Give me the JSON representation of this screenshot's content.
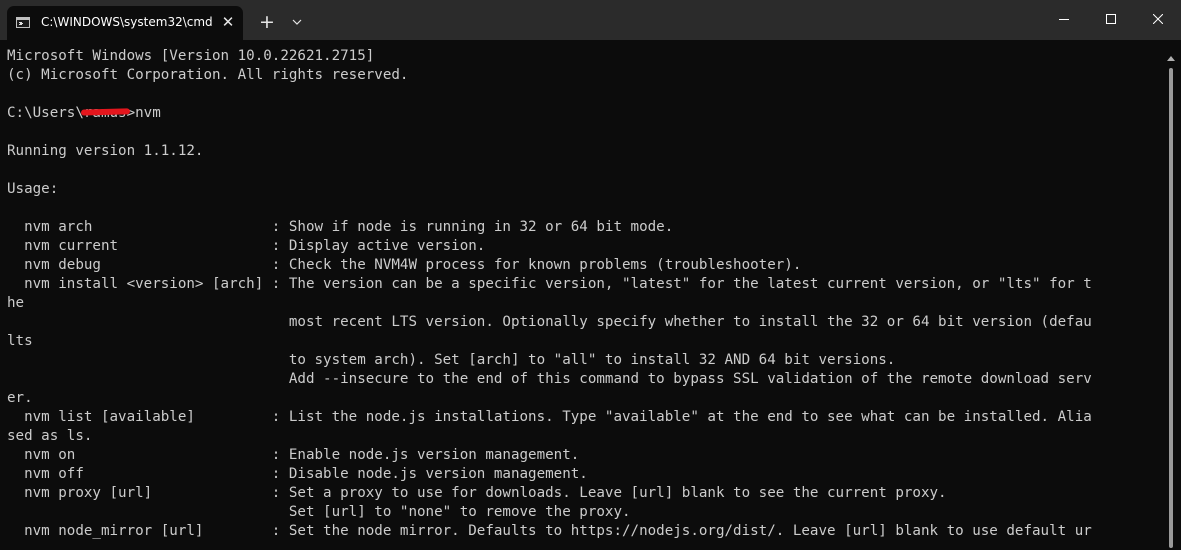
{
  "window": {
    "tab_title": "C:\\WINDOWS\\system32\\cmd",
    "tab_close_glyph": "✕",
    "new_tab_glyph": "+"
  },
  "terminal": {
    "lines": [
      "Microsoft Windows [Version 10.0.22621.2715]",
      "(c) Microsoft Corporation. All rights reserved.",
      "",
      "",
      "",
      "Running version 1.1.12.",
      "",
      "Usage:",
      "",
      "  nvm arch                     : Show if node is running in 32 or 64 bit mode.",
      "  nvm current                  : Display active version.",
      "  nvm debug                    : Check the NVM4W process for known problems (troubleshooter).",
      "  nvm install <version> [arch] : The version can be a specific version, \"latest\" for the latest current version, or \"lts\" for t",
      "he",
      "                                 most recent LTS version. Optionally specify whether to install the 32 or 64 bit version (defau",
      "lts",
      "                                 to system arch). Set [arch] to \"all\" to install 32 AND 64 bit versions.",
      "                                 Add --insecure to the end of this command to bypass SSL validation of the remote download serv",
      "er.",
      "  nvm list [available]         : List the node.js installations. Type \"available\" at the end to see what can be installed. Alia",
      "sed as ls.",
      "  nvm on                       : Enable node.js version management.",
      "  nvm off                      : Disable node.js version management.",
      "  nvm proxy [url]              : Set a proxy to use for downloads. Leave [url] blank to see the current proxy.",
      "                                 Set [url] to \"none\" to remove the proxy.",
      "  nvm node_mirror [url]        : Set the node mirror. Defaults to https://nodejs.org/dist/. Leave [url] blank to use default ur"
    ],
    "prompt": {
      "prefix": "C:\\Users\\",
      "user_redacted": "ramus",
      "suffix": ">nvm"
    }
  },
  "colors": {
    "titlebar": "#2b2b2b",
    "background": "#0c0c0c",
    "text": "#cccccc",
    "redaction": "#e4161d"
  }
}
